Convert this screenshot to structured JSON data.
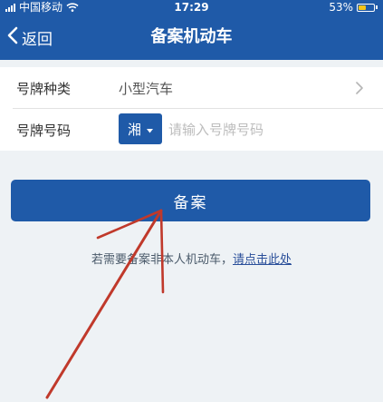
{
  "status_bar": {
    "carrier": "中国移动",
    "time": "17:29",
    "battery_percent": "53%",
    "battery_level": 0.53,
    "battery_color": "#f5c518"
  },
  "nav": {
    "back_label": "返回",
    "title": "备案机动车"
  },
  "form": {
    "plate_type": {
      "label": "号牌种类",
      "value": "小型汽车"
    },
    "plate_number": {
      "label": "号牌号码",
      "prefix": "湘",
      "placeholder": "请输入号牌号码",
      "value": ""
    }
  },
  "submit_label": "备案",
  "hint": {
    "text": "若需要备案非本人机动车，",
    "link": "请点击此处"
  },
  "colors": {
    "primary": "#1f5aa8",
    "background": "#eef2f5",
    "annotation_arrow": "#c0392b"
  },
  "icons": {
    "back": "chevron-left-icon",
    "row_arrow": "chevron-right-icon",
    "dropdown": "caret-down-icon",
    "wifi": "wifi-icon",
    "signal": "signal-icon",
    "battery": "battery-icon"
  }
}
